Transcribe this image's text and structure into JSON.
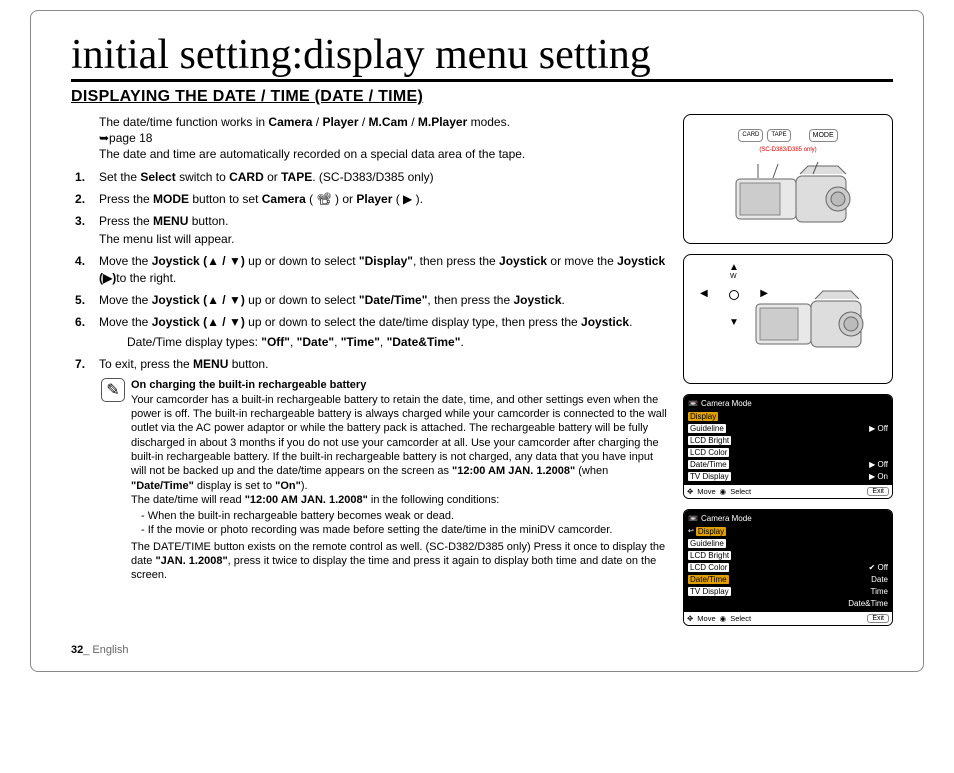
{
  "title": "initial setting:display menu setting",
  "section_title": "DISPLAYING THE DATE / TIME (DATE / TIME)",
  "intro_line_pre": "The date/time function works in ",
  "modes": {
    "camera": "Camera",
    "player": "Player",
    "mcam": "M.Cam",
    "mplayer": "M.Player"
  },
  "intro_line_post": " modes.",
  "page_ref": "➥page 18",
  "intro_line2": "The date and time are automatically recorded on a special data area of the tape.",
  "steps": {
    "s1_pre": "Set the ",
    "s1_select": "Select",
    "s1_mid": " switch to ",
    "s1_card": "CARD",
    "s1_or": " or ",
    "s1_tape": "TAPE",
    "s1_post": ". (SC-D383/D385 only)",
    "s2_pre": "Press the ",
    "s2_mode": "MODE",
    "s2_mid": " button to set ",
    "s2_camera": "Camera",
    "s2_camicon": " ( 📽 ) or ",
    "s2_player": "Player",
    "s2_playicon": " ( ▶ ).",
    "s3_pre": "Press the ",
    "s3_menu": "MENU",
    "s3_post": " button.",
    "s3_sub": "The menu list will appear.",
    "s4_pre": "Move the ",
    "s4_joy": "Joystick (▲ / ▼)",
    "s4_mid": " up or down to select ",
    "s4_display": "\"Display\"",
    "s4_mid2": ", then press the ",
    "s4_joy2": "Joystick",
    "s4_mid3": " or move the ",
    "s4_joy3": "Joystick (▶)",
    "s4_post": "to the right.",
    "s5_pre": "Move the ",
    "s5_joy": "Joystick (▲ / ▼)",
    "s5_mid": " up or down to select ",
    "s5_dt": "\"Date/Time\"",
    "s5_mid2": ", then press the ",
    "s5_joy2": "Joystick",
    "s5_post": ".",
    "s6_pre": "Move the ",
    "s6_joy": "Joystick (▲ / ▼)",
    "s6_mid": " up or down to select the date/time display type, then press the ",
    "s6_joy2": "Joystick",
    "s6_post": ".",
    "s6_sub_pre": "Date/Time display types: ",
    "s6_types": {
      "off": "\"Off\"",
      "date": "\"Date\"",
      "time": "\"Time\"",
      "dt": "\"Date&Time\""
    },
    "s7_pre": "To exit, press the ",
    "s7_menu": "MENU",
    "s7_post": " button."
  },
  "note": {
    "title": "On charging the built-in rechargeable battery",
    "p1": "Your camcorder has a built-in rechargeable battery to retain the date, time, and other settings even when the power is off. The built-in rechargeable battery is always charged while your camcorder is connected to the wall outlet via the AC power adaptor or while the battery pack is attached. The rechargeable battery will be fully discharged in about 3 months if you do not use your camcorder at all. Use your camcorder after charging the built-in rechargeable battery. If the built-in rechargeable battery is not charged, any data that you have input will not be backed up and the date/time appears on the screen as ",
    "p1_ts_a": "\"12:00 AM JAN. 1.2008\"",
    "p1_mid1": " (when ",
    "p1_dt": "\"Date/Time\"",
    "p1_mid2": " display is set to ",
    "p1_on": "\"On\"",
    "p1_post1": ").",
    "p2_pre": "The date/time will read ",
    "p2_ts": "\"12:00 AM JAN. 1.2008\"",
    "p2_post": " in the following conditions:",
    "bullets": {
      "b1": "When the built-in rechargeable battery becomes weak or dead.",
      "b2": "If the movie or photo recording was made before setting the date/time in the miniDV camcorder."
    },
    "p3_pre": "The DATE/TIME button exists on the remote control as well. (SC-D382/D385 only) Press it once to display the date ",
    "p3_date": "\"JAN. 1.2008\"",
    "p3_post": ", press it twice to display the time and press it again to display both time and date on the screen."
  },
  "footer": {
    "num": "32",
    "lang": "_ English"
  },
  "device_top": {
    "card": "CARD",
    "tape": "TAPE",
    "mode": "MODE",
    "model": "(SC-D383/D385 only)"
  },
  "lcd1": {
    "header": "Camera Mode",
    "rows": {
      "r1": "Display",
      "r2": "Guideline",
      "r2v": "▶ Off",
      "r3": "LCD Bright",
      "r4": "LCD Color",
      "r5": "Date/Time",
      "r5v": "▶ Off",
      "r6": "TV Display",
      "r6v": "▶ On"
    },
    "footer": {
      "move": "Move",
      "select": "Select",
      "exit": "Exit"
    }
  },
  "lcd2": {
    "header": "Camera Mode",
    "rows": {
      "r1": "Display",
      "r2": "Guideline",
      "r3": "LCD Bright",
      "r4": "LCD Color",
      "r4v": "Off",
      "r5": "Date/Time",
      "r5v": "Date",
      "r6": "TV Display",
      "r6v": "Time",
      "r7v": "Date&Time"
    },
    "footer": {
      "move": "Move",
      "select": "Select",
      "exit": "Exit"
    }
  },
  "joystick_label": "W"
}
